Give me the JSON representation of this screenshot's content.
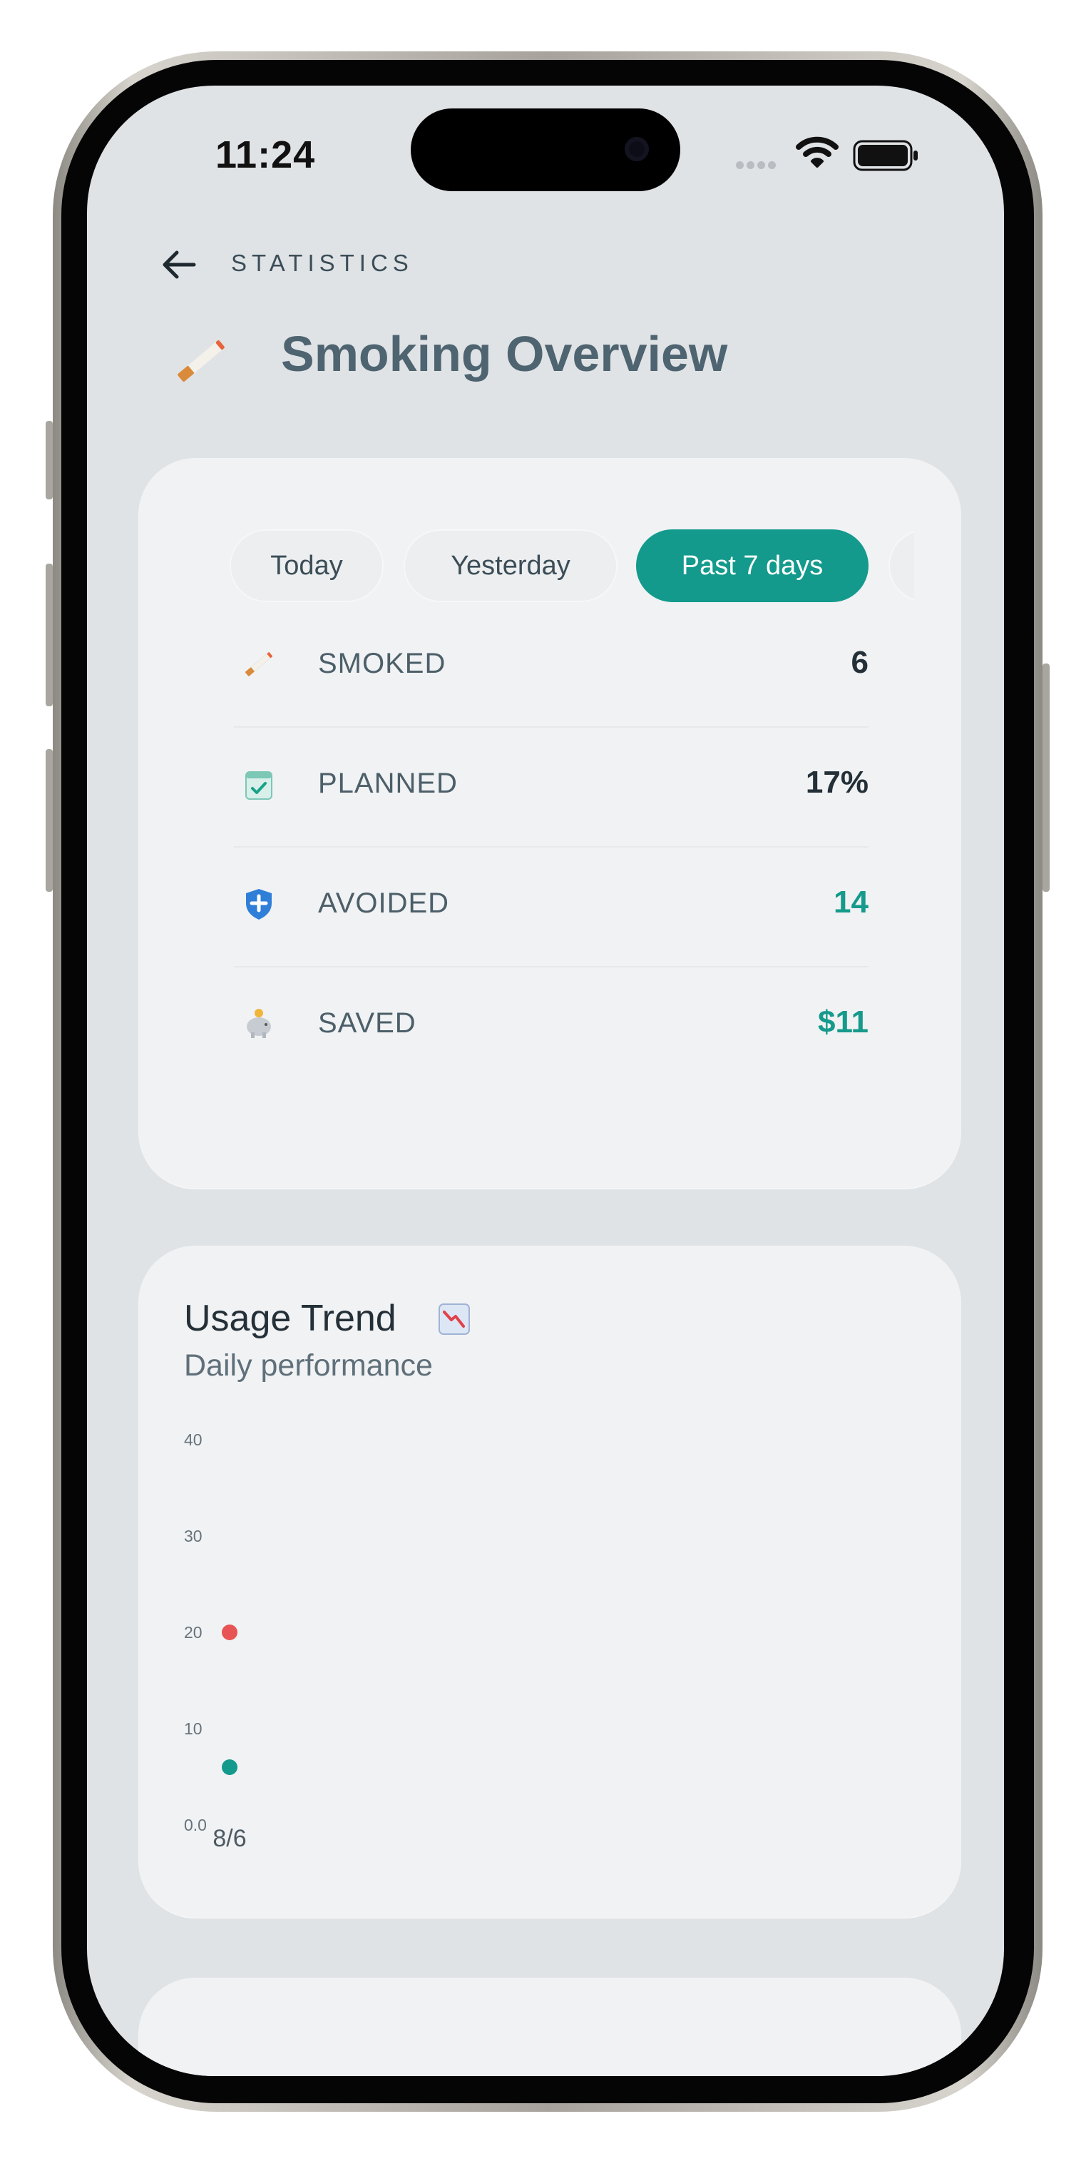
{
  "status_bar": {
    "time": "11:24"
  },
  "header": {
    "back_label": "STATISTICS",
    "title": "Smoking Overview",
    "title_icon": "cigarette-icon"
  },
  "period_tabs": [
    {
      "label": "Today",
      "active": false
    },
    {
      "label": "Yesterday",
      "active": false
    },
    {
      "label": "Past 7 days",
      "active": true
    },
    {
      "label": "",
      "active": false
    }
  ],
  "stats": [
    {
      "icon": "cigarette-icon",
      "label": "SMOKED",
      "value": "6",
      "accent": false
    },
    {
      "icon": "calendar-check-icon",
      "label": "PLANNED",
      "value": "17%",
      "accent": false
    },
    {
      "icon": "shield-icon",
      "label": "AVOIDED",
      "value": "14",
      "accent": true
    },
    {
      "icon": "piggy-bank-icon",
      "label": "SAVED",
      "value": "$11",
      "accent": true
    }
  ],
  "usage_trend": {
    "title": "Usage Trend",
    "title_icon": "chart-decreasing-icon",
    "subtitle": "Daily performance"
  },
  "chart_data": {
    "type": "scatter",
    "title": "",
    "xlabel": "",
    "ylabel": "",
    "categories": [
      "8/6"
    ],
    "y_ticks": [
      "40",
      "30",
      "20",
      "10",
      "0.0"
    ],
    "ylim": [
      0,
      40
    ],
    "grid": false,
    "series": [
      {
        "values": [
          20
        ],
        "color": "#e85454"
      },
      {
        "values": [
          6
        ],
        "color": "#139a8c"
      }
    ]
  },
  "colors": {
    "accent": "#139a8c",
    "danger": "#e85454",
    "background": "#e0e3e6",
    "card": "#f1f2f4"
  }
}
